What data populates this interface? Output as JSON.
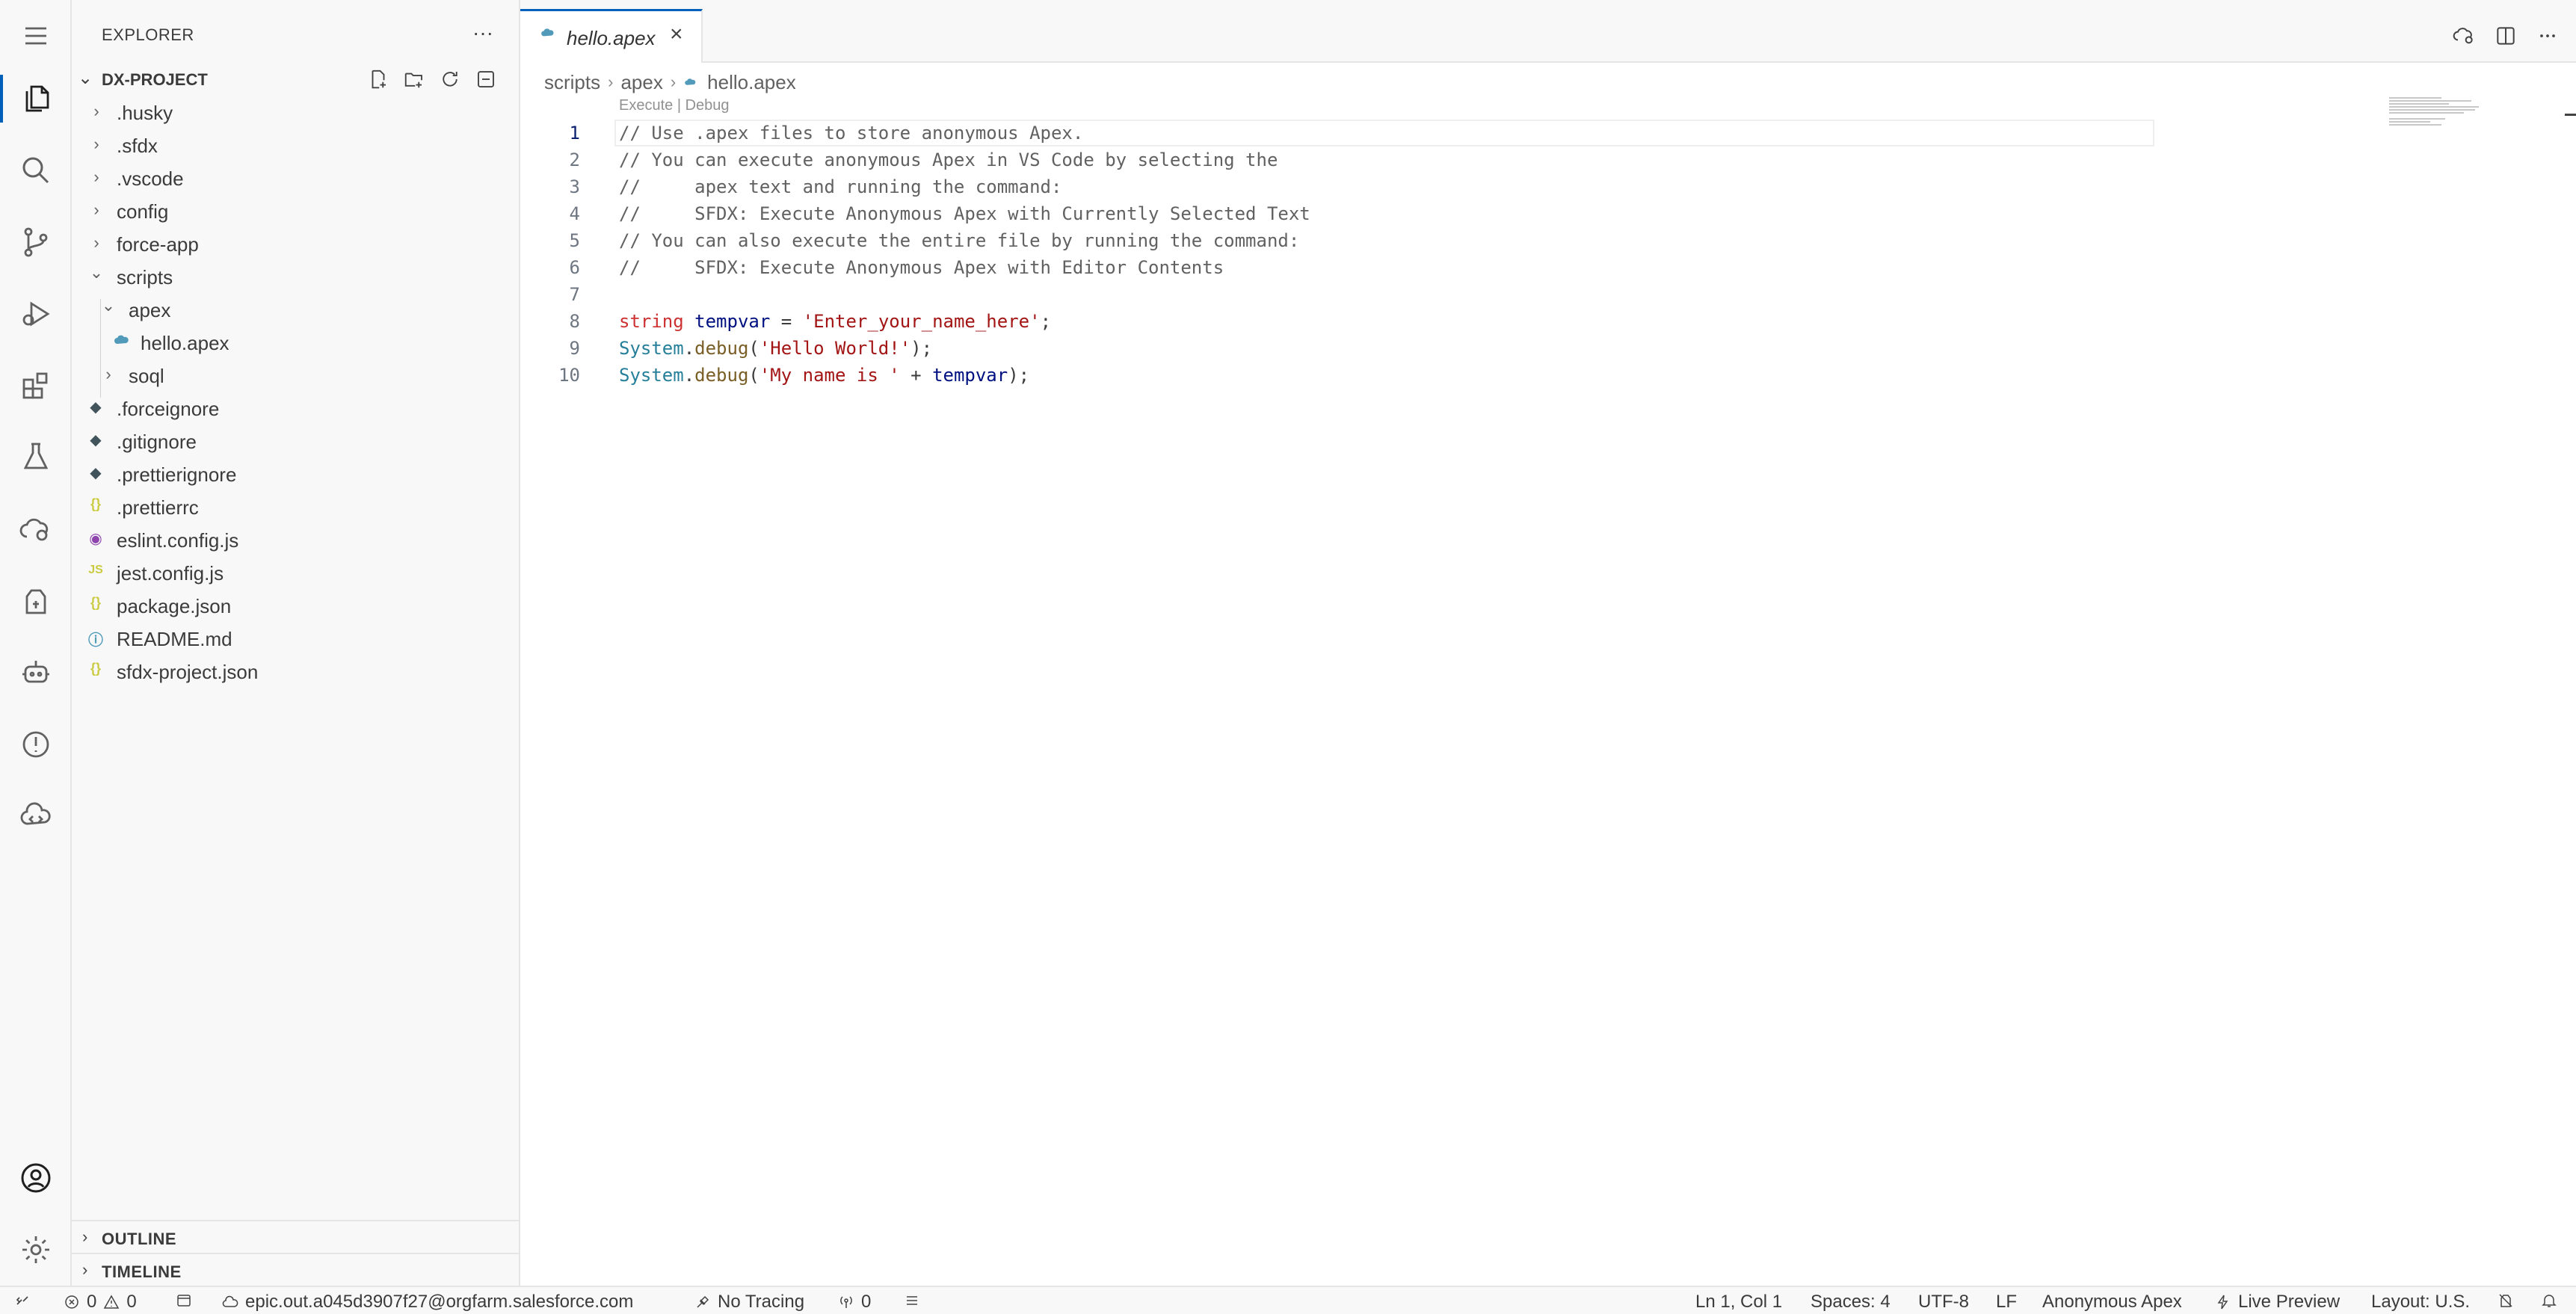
{
  "activity_bar": {
    "icons": [
      "menu-icon",
      "files-icon",
      "search-icon",
      "source-control-icon",
      "run-debug-icon",
      "extensions-icon",
      "testing-icon",
      "org-browser-icon",
      "apex-replay-icon",
      "agent-icon",
      "problems-icon",
      "salesforce-cloud-icon",
      "account-icon",
      "settings-gear-icon"
    ]
  },
  "sidebar": {
    "title": "EXPLORER",
    "project_name": "DX-PROJECT",
    "tree": [
      {
        "label": ".husky",
        "type": "folder"
      },
      {
        "label": ".sfdx",
        "type": "folder"
      },
      {
        "label": ".vscode",
        "type": "folder"
      },
      {
        "label": "config",
        "type": "folder"
      },
      {
        "label": "force-app",
        "type": "folder"
      },
      {
        "label": "scripts",
        "type": "folder-open"
      },
      {
        "label": "apex",
        "type": "folder-open"
      },
      {
        "label": "hello.apex",
        "type": "apex-file"
      },
      {
        "label": "soql",
        "type": "folder"
      },
      {
        "label": ".forceignore",
        "type": "ignore-file"
      },
      {
        "label": ".gitignore",
        "type": "ignore-file"
      },
      {
        "label": ".prettierignore",
        "type": "ignore-file"
      },
      {
        "label": ".prettierrc",
        "type": "json-file"
      },
      {
        "label": "eslint.config.js",
        "type": "eslint-file"
      },
      {
        "label": "jest.config.js",
        "type": "js-file"
      },
      {
        "label": "package.json",
        "type": "json-file"
      },
      {
        "label": "README.md",
        "type": "info-file"
      },
      {
        "label": "sfdx-project.json",
        "type": "json-file"
      }
    ],
    "outline_label": "OUTLINE",
    "timeline_label": "TIMELINE"
  },
  "editor": {
    "tab_label": "hello.apex",
    "breadcrumb": [
      "scripts",
      "apex",
      "hello.apex"
    ],
    "codelens": {
      "execute": "Execute",
      "separator": " | ",
      "debug": "Debug"
    },
    "line_numbers": [
      "1",
      "2",
      "3",
      "4",
      "5",
      "6",
      "7",
      "8",
      "9",
      "10"
    ],
    "code_lines": [
      "// Use .apex files to store anonymous Apex.",
      "// You can execute anonymous Apex in VS Code by selecting the",
      "//     apex text and running the command:",
      "//     SFDX: Execute Anonymous Apex with Currently Selected Text",
      "// You can also execute the entire file by running the command:",
      "//     SFDX: Execute Anonymous Apex with Editor Contents",
      "",
      "string tempvar = 'Enter_your_name_here';",
      "System.debug('Hello World!');",
      "System.debug('My name is ' + tempvar);"
    ],
    "tokens": {
      "kw_string": "string",
      "var": "tempvar",
      "eq": " = ",
      "str_name": "'Enter_your_name_here'",
      "semi": ";",
      "system": "System",
      "dot": ".",
      "debug": "debug",
      "lparen": "(",
      "str_hello": "'Hello World!'",
      "rparen_semi": ");",
      "str_myname": "'My name is '",
      "plus": " + ",
      "var2": "tempvar"
    }
  },
  "status_bar": {
    "errors": "0",
    "warnings": "0",
    "org": "epic.out.a045d3907f27@orgfarm.salesforce.com",
    "tracing": "No Tracing",
    "ports": "0",
    "position": "Ln 1, Col 1",
    "spaces": "Spaces: 4",
    "encoding": "UTF-8",
    "eol": "LF",
    "language": "Anonymous Apex",
    "live_preview": "Live Preview",
    "layout": "Layout: U.S."
  },
  "colors": {
    "accent": "#005fb8",
    "background": "#f8f8f8",
    "editor_bg": "#ffffff",
    "apex_icon": "#519aba",
    "json_icon": "#cbcb41",
    "eslint_icon": "#8e44ad"
  }
}
